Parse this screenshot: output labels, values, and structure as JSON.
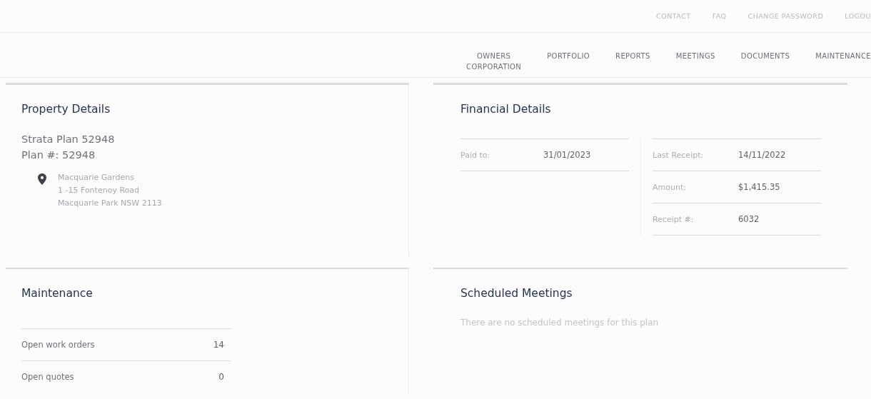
{
  "top_links": [
    "CONTACT",
    "FAQ",
    "CHANGE PASSWORD",
    "LOGOU"
  ],
  "nav": [
    {
      "label": "OWNERS\nCORPORATION",
      "selected": false
    },
    {
      "label": "PORTFOLIO",
      "selected": false
    },
    {
      "label": "REPORTS",
      "selected": false
    },
    {
      "label": "MEETINGS",
      "selected": false
    },
    {
      "label": "DOCUMENTS",
      "selected": false
    },
    {
      "label": "MAINTENANCE",
      "selected": false
    }
  ],
  "property_details": {
    "title": "Property Details",
    "plan_name": "Strata Plan 52948",
    "plan_number": "Plan #: 52948",
    "address": [
      "Macquarie Gardens",
      "1 -15 Fontenoy Road",
      "Macquarie Park NSW 2113"
    ]
  },
  "financial_details": {
    "title": "Financial Details",
    "left": [
      {
        "label": "Paid to:",
        "value": "31/01/2023"
      }
    ],
    "right": [
      {
        "label": "Last Receipt:",
        "value": "14/11/2022"
      },
      {
        "label": "Amount:",
        "value": "$1,415.35"
      },
      {
        "label": "Receipt #:",
        "value": "6032"
      }
    ]
  },
  "maintenance": {
    "title": "Maintenance",
    "rows": [
      {
        "label": "Open work orders",
        "value": "14"
      },
      {
        "label": "Open quotes",
        "value": "0"
      }
    ]
  },
  "scheduled_meetings": {
    "title": "Scheduled Meetings",
    "message": "There are no scheduled meetings for this plan"
  }
}
